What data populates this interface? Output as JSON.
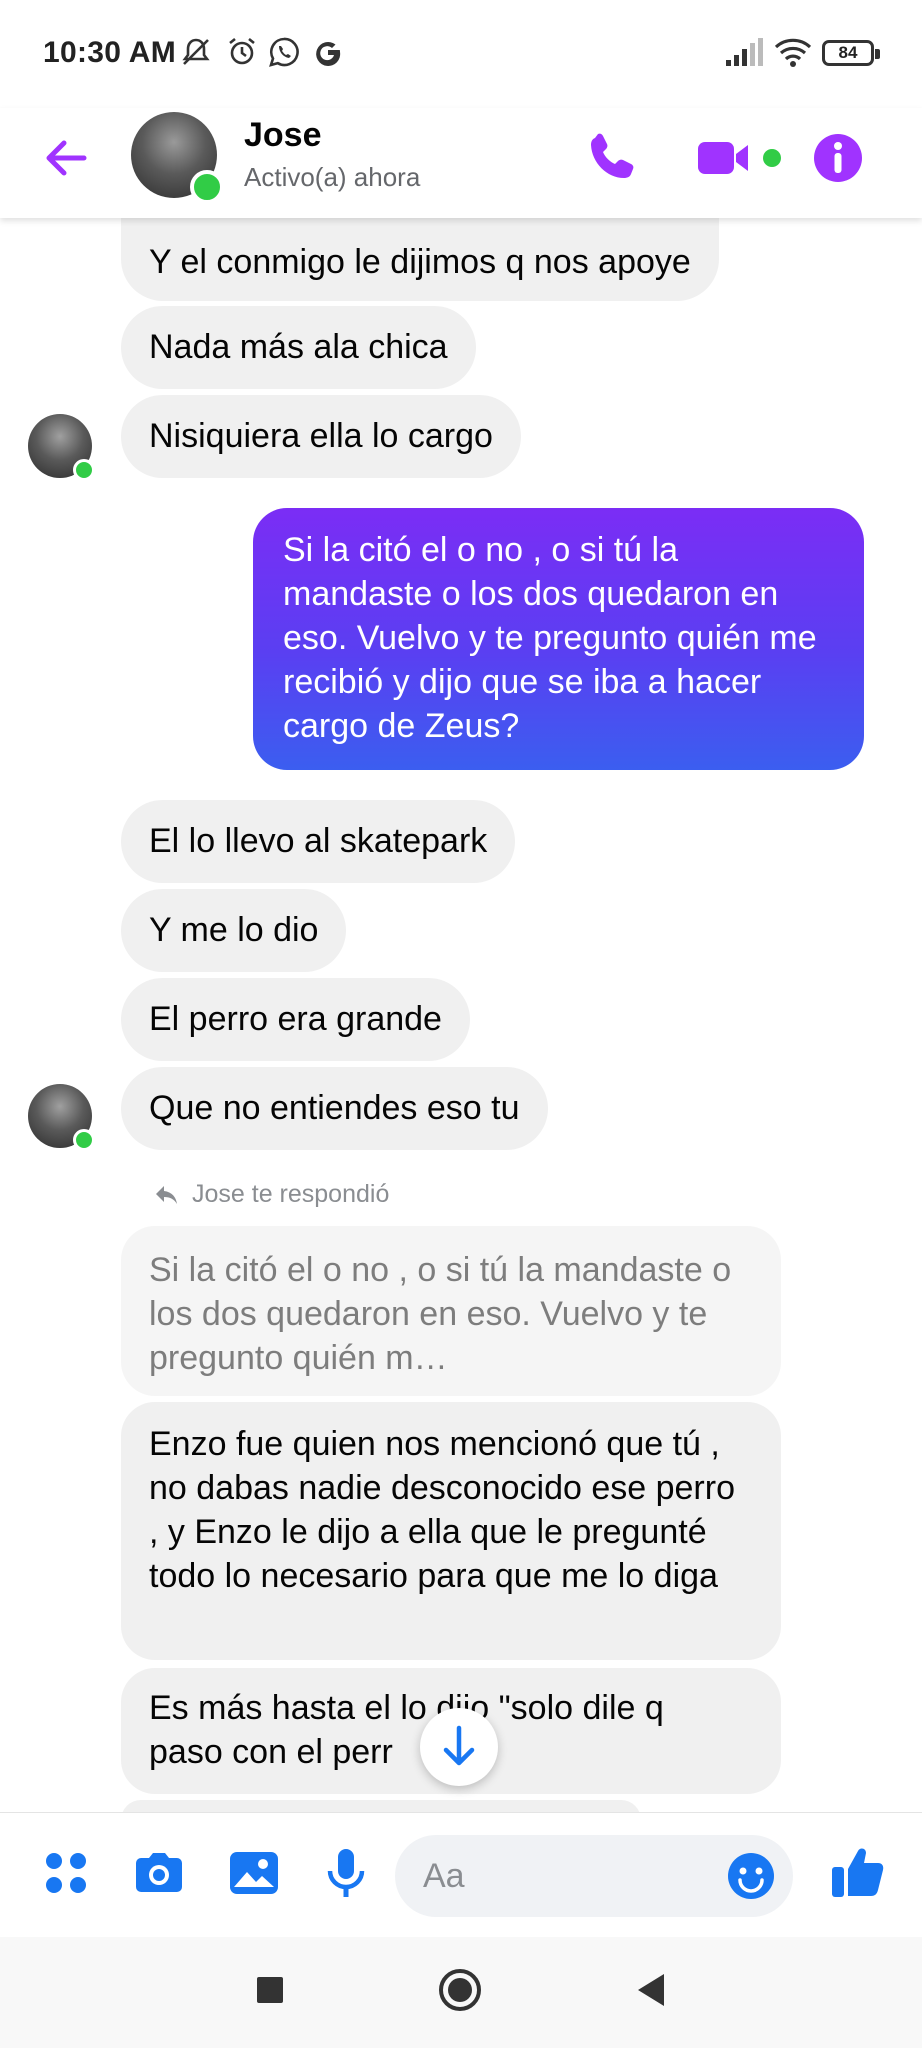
{
  "status_bar": {
    "time": "10:30 AM",
    "icons_left": [
      "mute-icon",
      "alarm-icon",
      "whatsapp-icon",
      "google-icon"
    ],
    "icons_right": [
      "signal-icon",
      "wifi-icon"
    ],
    "battery": "84"
  },
  "header": {
    "contact_name": "Jose",
    "contact_status": "Activo(a) ahora",
    "accent": "#a033ff",
    "online_color": "#31cc46"
  },
  "messages": {
    "m1": "Y el conmigo le dijimos q nos apoye",
    "m2": "Nada más ala chica",
    "m3": "Nisiquiera ella lo cargo",
    "m4": "Si la citó el o no , o si tú la mandaste o los dos quedaron en eso. Vuelvo y te pregunto quién me recibió y dijo que se iba a hacer cargo de Zeus?",
    "m5": "El lo llevo al skatepark",
    "m6": "Y me lo dio",
    "m7": "El perro era grande",
    "m8": "Que no entiendes eso tu",
    "reply_note": "Jose te respondió",
    "quoted": "Si la citó el o no , o si tú la mandaste o los dos quedaron en eso. Vuelvo y te pregunto quién m…",
    "m9": "Enzo fue quien nos mencionó que tú , no dabas nadie desconocido ese perro , y Enzo le dijo a ella que le pregunté todo lo necesario para que me lo diga",
    "m10_line1": "Es más hasta el lo dijo \"solo dile q",
    "m10_line2": "paso con el perr",
    "m10_tail": "a\""
  },
  "composer": {
    "placeholder": "Aa",
    "icon_color": "#1877f2"
  }
}
